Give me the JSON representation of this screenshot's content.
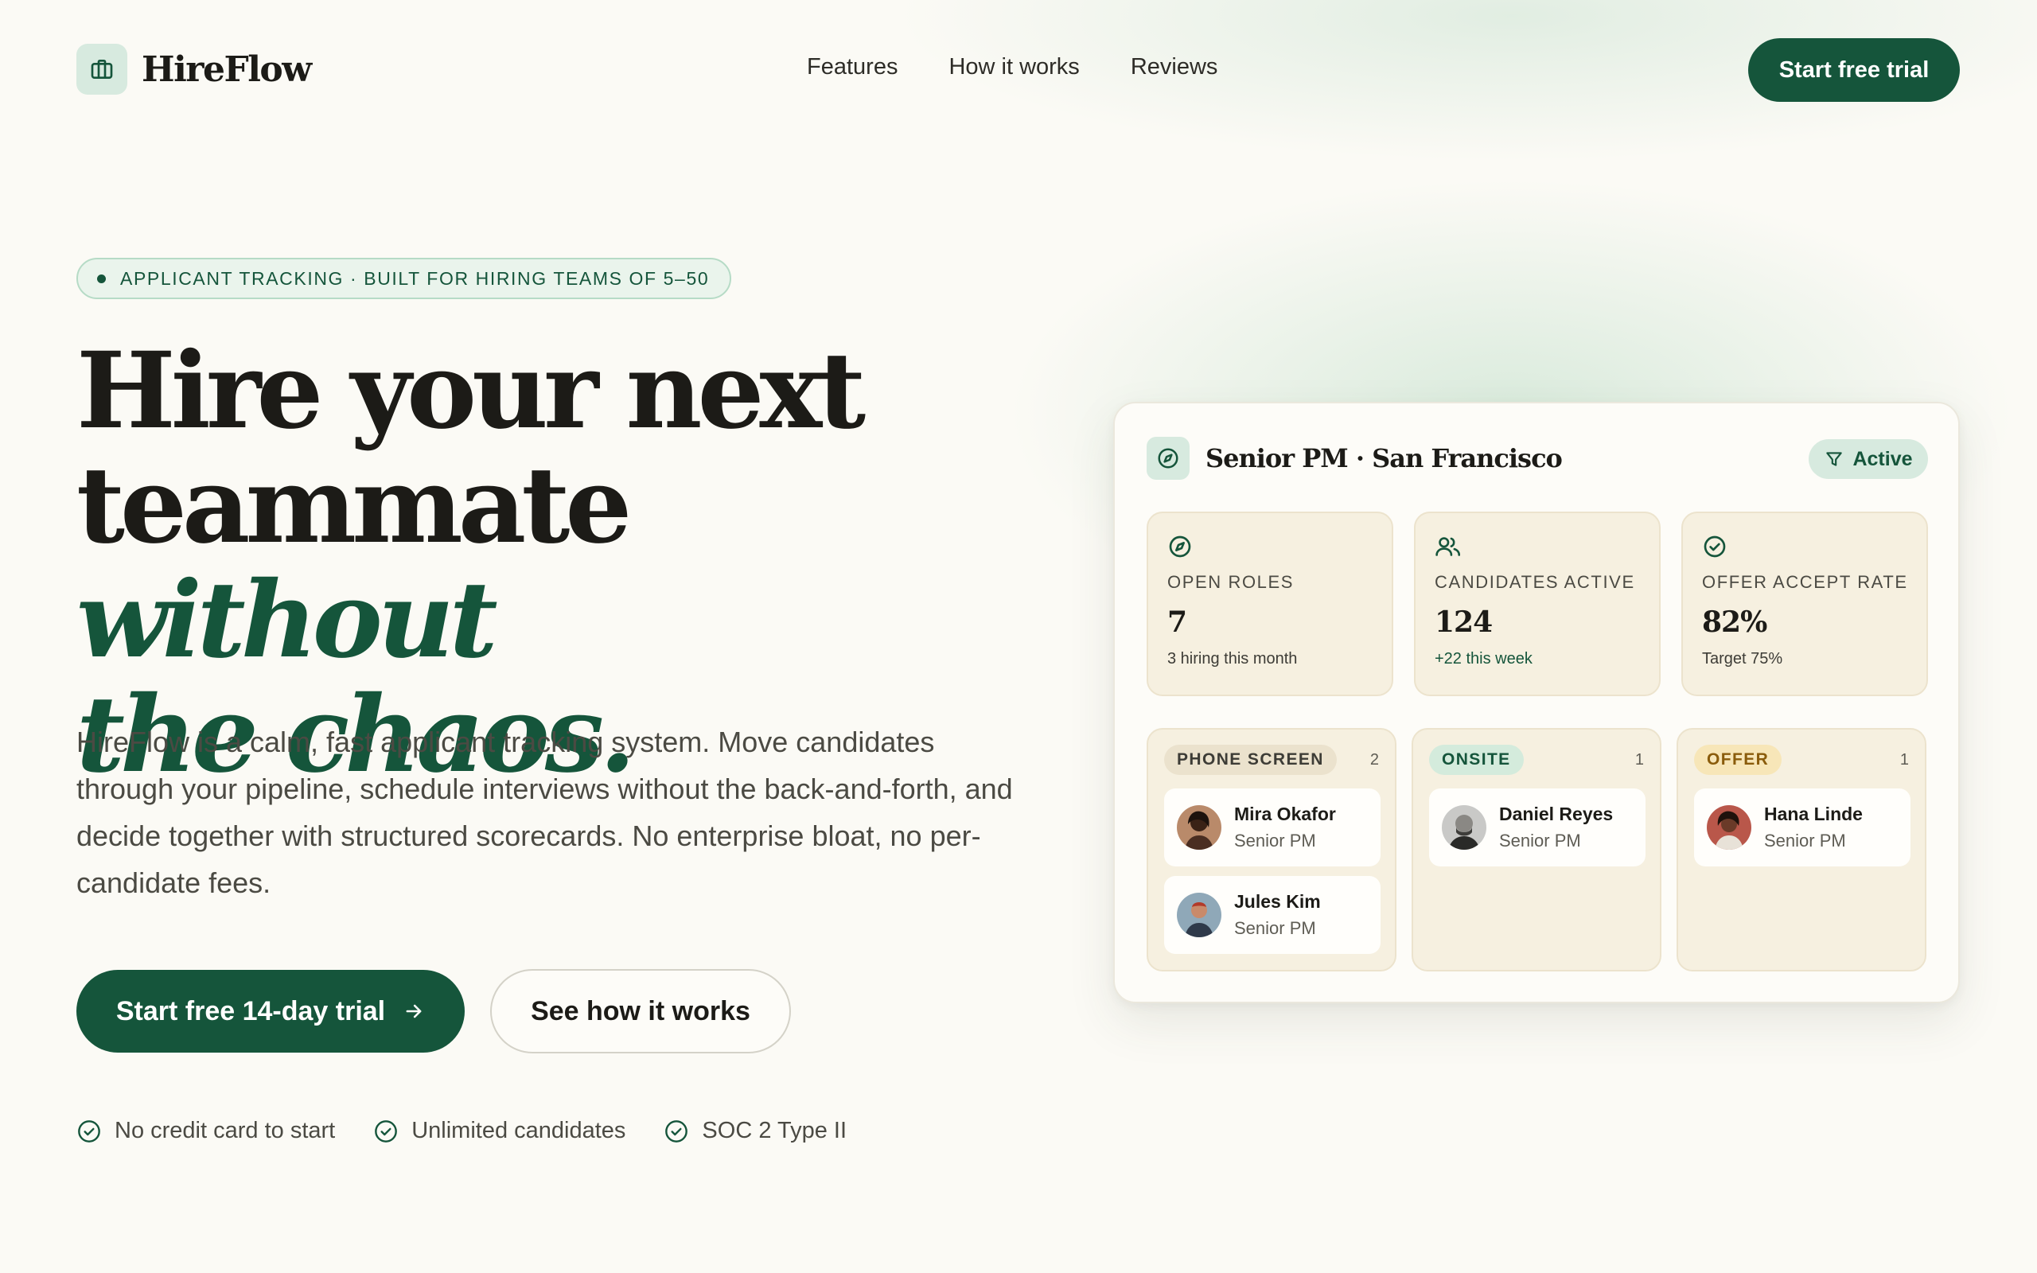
{
  "nav": {
    "brand": "HireFlow",
    "links": [
      "Features",
      "How it works",
      "Reviews"
    ],
    "cta": "Start free trial"
  },
  "hero": {
    "eyebrow": "APPLICANT TRACKING · BUILT FOR HIRING TEAMS OF 5–50",
    "headline_line1": "Hire your next",
    "headline_line2_plain": "teammate",
    "headline_line2_accent": "without",
    "headline_line3_accent": "the chaos.",
    "subtext": "HireFlow is a calm, fast applicant tracking system. Move candidates through your pipeline, schedule interviews without the back-and-forth, and decide together with structured scorecards. No enterprise bloat, no per-candidate fees.",
    "primary_cta": "Start free 14-day trial",
    "secondary_cta": "See how it works",
    "trust_items": [
      "No credit card to start",
      "Unlimited candidates",
      "SOC 2 Type II"
    ]
  },
  "dashboard": {
    "title": "Senior PM · San Francisco",
    "status": "Active",
    "stats": [
      {
        "label": "OPEN ROLES",
        "value": "7",
        "note": "3 hiring this month",
        "icon": "compass-icon"
      },
      {
        "label": "CANDIDATES ACTIVE",
        "value": "124",
        "note": "+22 this week",
        "icon": "users-icon"
      },
      {
        "label": "OFFER ACCEPT RATE",
        "value": "82%",
        "note": "Target 75%",
        "icon": "check-circle-icon"
      }
    ],
    "pipeline": [
      {
        "stage": "PHONE SCREEN",
        "count": "2",
        "candidates": [
          {
            "name": "Mira Okafor",
            "role": "Senior PM"
          },
          {
            "name": "Jules Kim",
            "role": "Senior PM"
          }
        ]
      },
      {
        "stage": "ONSITE",
        "count": "1",
        "candidates": [
          {
            "name": "Daniel Reyes",
            "role": "Senior PM"
          }
        ]
      },
      {
        "stage": "OFFER",
        "count": "1",
        "candidates": [
          {
            "name": "Hana Linde",
            "role": "Senior PM"
          }
        ]
      }
    ]
  },
  "colors": {
    "brand_green": "#15553b",
    "mint": "#d7eadf",
    "background": "#fbfaf5",
    "card_tan": "#f6f0e0",
    "offer_amber": "#f7e6b8"
  }
}
